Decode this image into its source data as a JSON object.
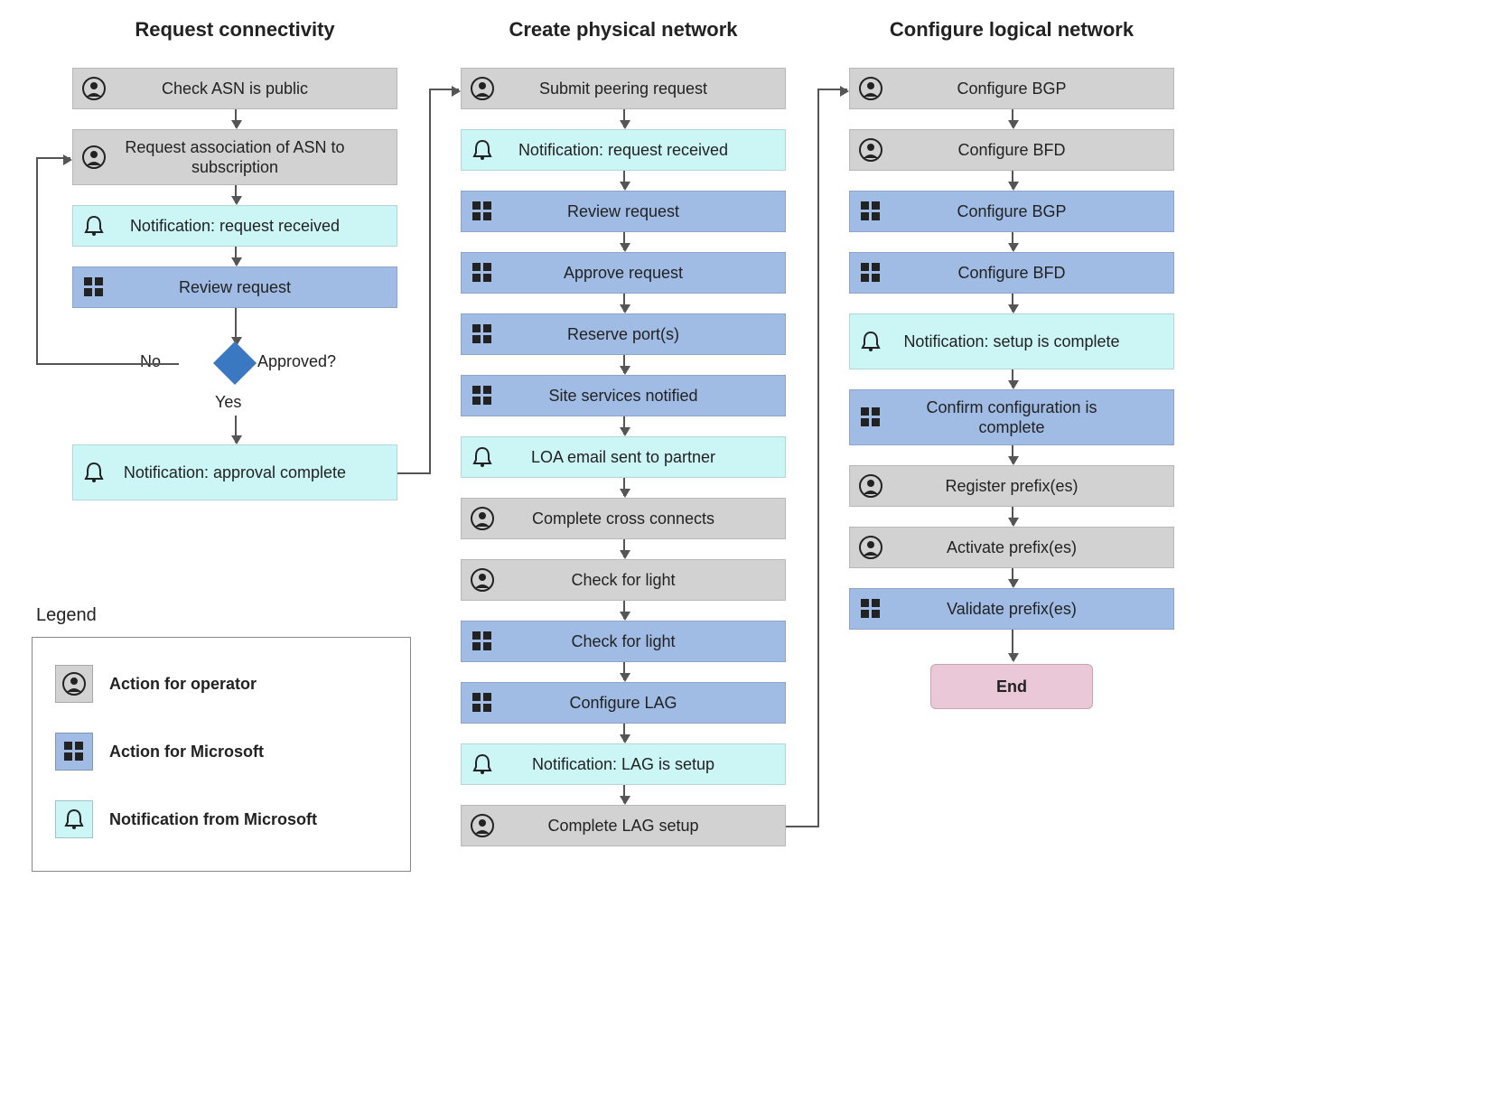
{
  "columns": {
    "c1": {
      "title": "Request connectivity"
    },
    "c2": {
      "title": "Create physical network"
    },
    "c3": {
      "title": "Configure logical network"
    }
  },
  "c1_steps": {
    "s1": "Check ASN is public",
    "s2": "Request association of ASN to subscription",
    "s3": "Notification: request received",
    "s4": "Review request",
    "s5": "Notification: approval complete"
  },
  "c2_steps": {
    "s1": "Submit peering request",
    "s2": "Notification: request received",
    "s3": "Review request",
    "s4": "Approve request",
    "s5": "Reserve port(s)",
    "s6": "Site services notified",
    "s7": "LOA email sent to partner",
    "s8": "Complete cross connects",
    "s9": "Check for light",
    "s10": "Check for light",
    "s11": "Configure LAG",
    "s12": "Notification: LAG is setup",
    "s13": "Complete LAG setup"
  },
  "c3_steps": {
    "s1": "Configure BGP",
    "s2": "Configure BFD",
    "s3": "Configure BGP",
    "s4": "Configure BFD",
    "s5": "Notification: setup is complete",
    "s6": "Confirm configuration is complete",
    "s7": "Register prefix(es)",
    "s8": "Activate prefix(es)",
    "s9": "Validate prefix(es)"
  },
  "decision": {
    "label": "Approved?",
    "yes": "Yes",
    "no": "No"
  },
  "end": "End",
  "legend": {
    "title": "Legend",
    "op": "Action for operator",
    "ms": "Action for Microsoft",
    "not": "Notification from Microsoft"
  },
  "icons": {
    "person": "person-icon",
    "microsoft": "microsoft-icon",
    "bell": "bell-icon"
  }
}
